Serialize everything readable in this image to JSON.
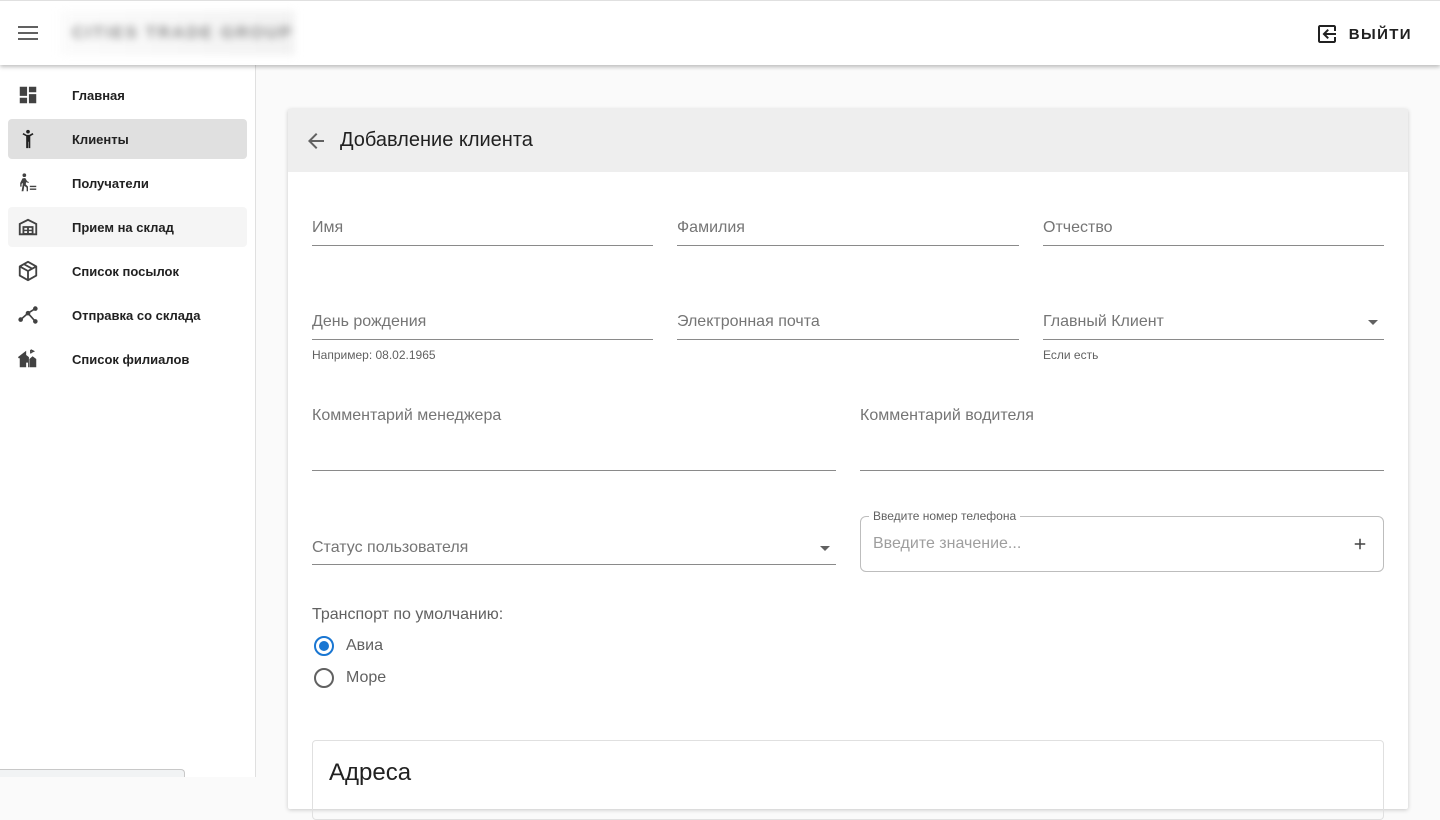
{
  "header": {
    "brand": "CITIES TRADE GROUP",
    "logout_label": "ВЫЙТИ"
  },
  "sidebar": {
    "items": [
      {
        "label": "Главная",
        "icon": "dashboard-icon"
      },
      {
        "label": "Клиенты",
        "icon": "person-icon",
        "active": true
      },
      {
        "label": "Получатели",
        "icon": "recipients-icon"
      },
      {
        "label": "Прием на склад",
        "icon": "warehouse-icon"
      },
      {
        "label": "Список посылок",
        "icon": "package-icon"
      },
      {
        "label": "Отправка со склада",
        "icon": "route-icon"
      },
      {
        "label": "Список филиалов",
        "icon": "branches-icon"
      }
    ]
  },
  "form": {
    "title": "Добавление клиента",
    "first_name": {
      "label": "Имя",
      "value": ""
    },
    "last_name": {
      "label": "Фамилия",
      "value": ""
    },
    "middle_name": {
      "label": "Отчество",
      "value": ""
    },
    "birthday": {
      "label": "День рождения",
      "hint": "Например: 08.02.1965",
      "value": ""
    },
    "email": {
      "label": "Электронная почта",
      "value": ""
    },
    "main_client": {
      "label": "Главный Клиент",
      "hint": "Если есть",
      "value": ""
    },
    "manager_comment": {
      "label": "Комментарий менеджера",
      "value": ""
    },
    "driver_comment": {
      "label": "Комментарий водителя",
      "value": ""
    },
    "user_status": {
      "label": "Статус пользователя",
      "value": ""
    },
    "phone": {
      "legend": "Введите номер телефона",
      "placeholder": "Введите значение..."
    },
    "transport": {
      "label": "Транспорт по умолчанию:",
      "options": [
        "Авиа",
        "Море"
      ],
      "selected": "Авиа"
    },
    "addresses_title": "Адреса"
  },
  "colors": {
    "accent": "#1976d2",
    "active_nav": "#e0e0e0",
    "card_header": "#eeeeee"
  }
}
